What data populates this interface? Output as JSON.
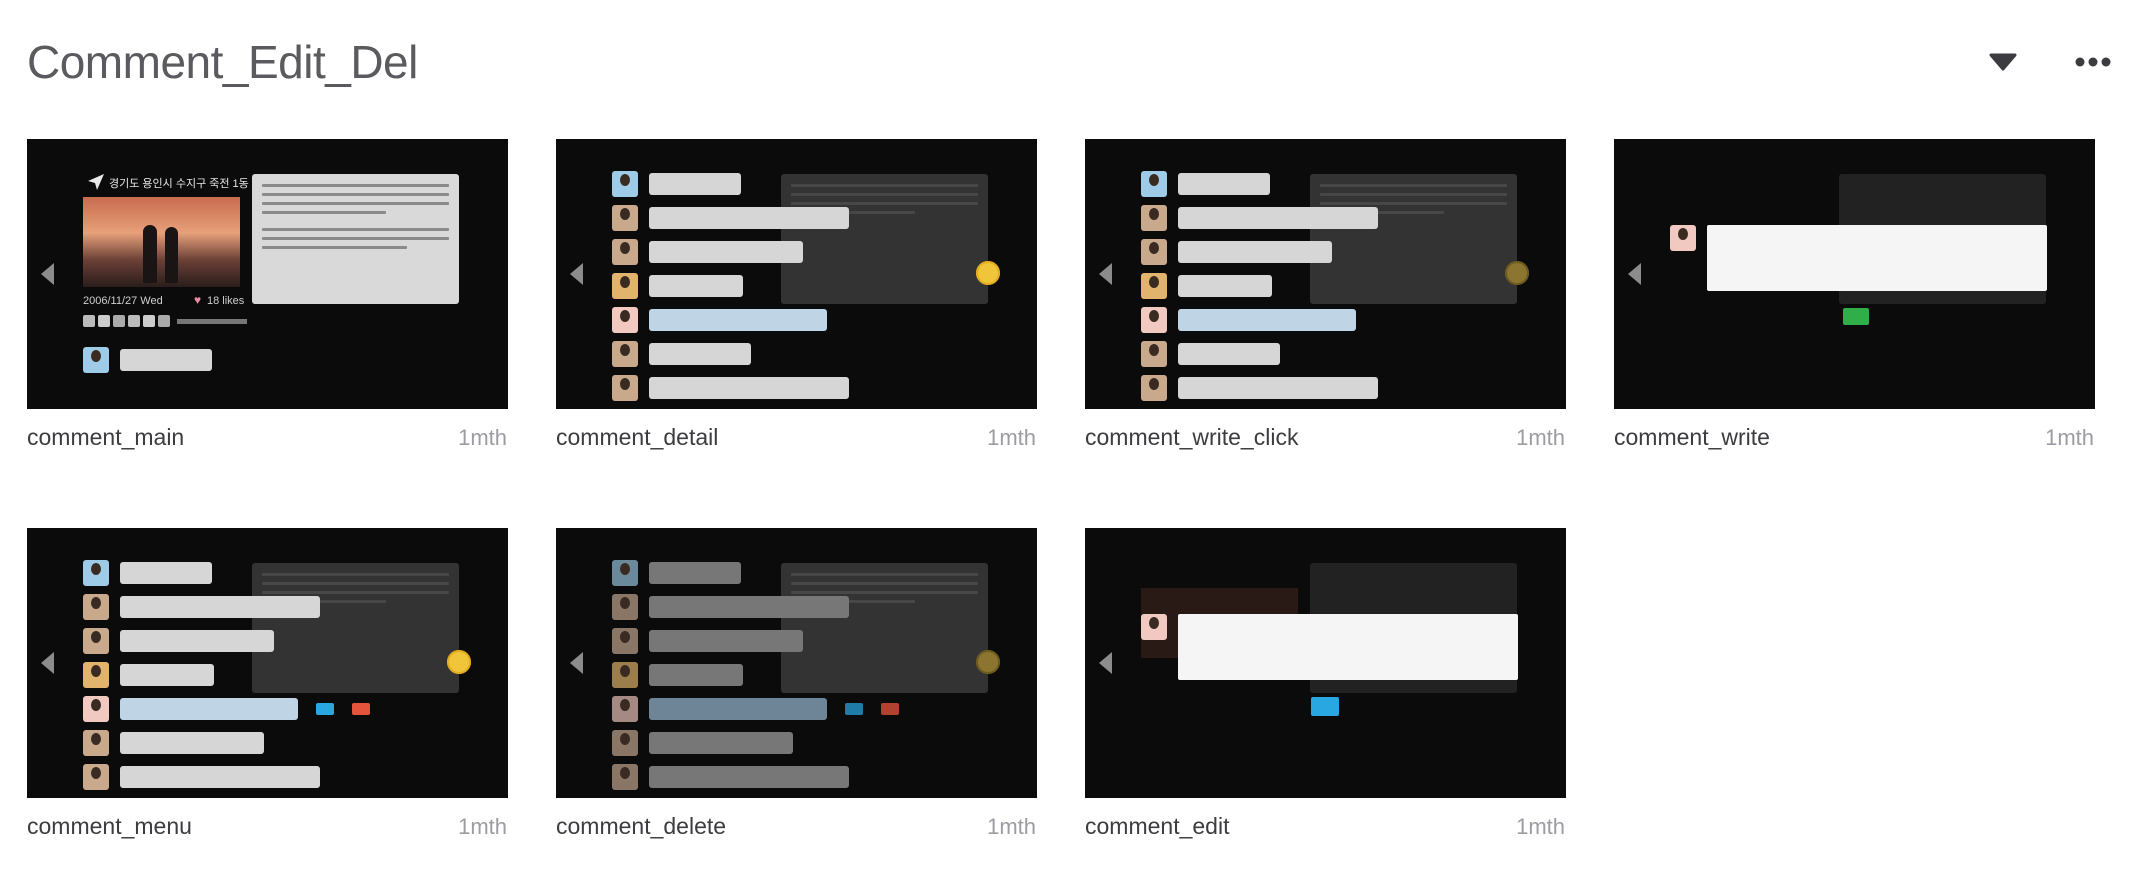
{
  "title": "Comment_Edit_Del",
  "header": {
    "dropdown_icon": "caret-down-icon",
    "more_icon": "more-horizontal-icon"
  },
  "cards": [
    {
      "name": "comment_main",
      "age": "1mth"
    },
    {
      "name": "comment_detail",
      "age": "1mth"
    },
    {
      "name": "comment_write_click",
      "age": "1mth"
    },
    {
      "name": "comment_write",
      "age": "1mth"
    },
    {
      "name": "comment_menu",
      "age": "1mth"
    },
    {
      "name": "comment_delete",
      "age": "1mth"
    },
    {
      "name": "comment_edit",
      "age": "1mth"
    }
  ],
  "thumb_text": {
    "location": "경기도 용인시 수지구 죽전 1동",
    "date": "2006/11/27  Wed",
    "likes": "18 likes"
  },
  "colors": {
    "thumb_bg": "#0b0b0b",
    "accent_green": "#2fae4a",
    "accent_blue": "#29a7e1",
    "accent_red": "#e4543c"
  }
}
